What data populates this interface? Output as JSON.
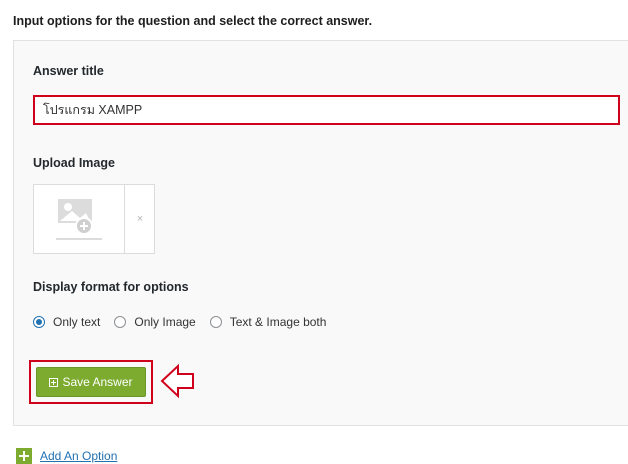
{
  "instruction": "Input options for the question and select the correct answer.",
  "answer_title": {
    "label": "Answer title",
    "value": "โปรแกรม XAMPP"
  },
  "upload_image": {
    "label": "Upload Image",
    "remove_symbol": "×",
    "icon": "image-placeholder-icon"
  },
  "display_format": {
    "label": "Display format for options",
    "options": [
      {
        "label": "Only text",
        "checked": true
      },
      {
        "label": "Only Image",
        "checked": false
      },
      {
        "label": "Text & Image both",
        "checked": false
      }
    ]
  },
  "save_button": {
    "label": "Save Answer",
    "color": "#7cab2f"
  },
  "add_option": {
    "label": "Add An Option"
  },
  "colors": {
    "highlight": "#d0021b",
    "accent": "#2271b1"
  }
}
